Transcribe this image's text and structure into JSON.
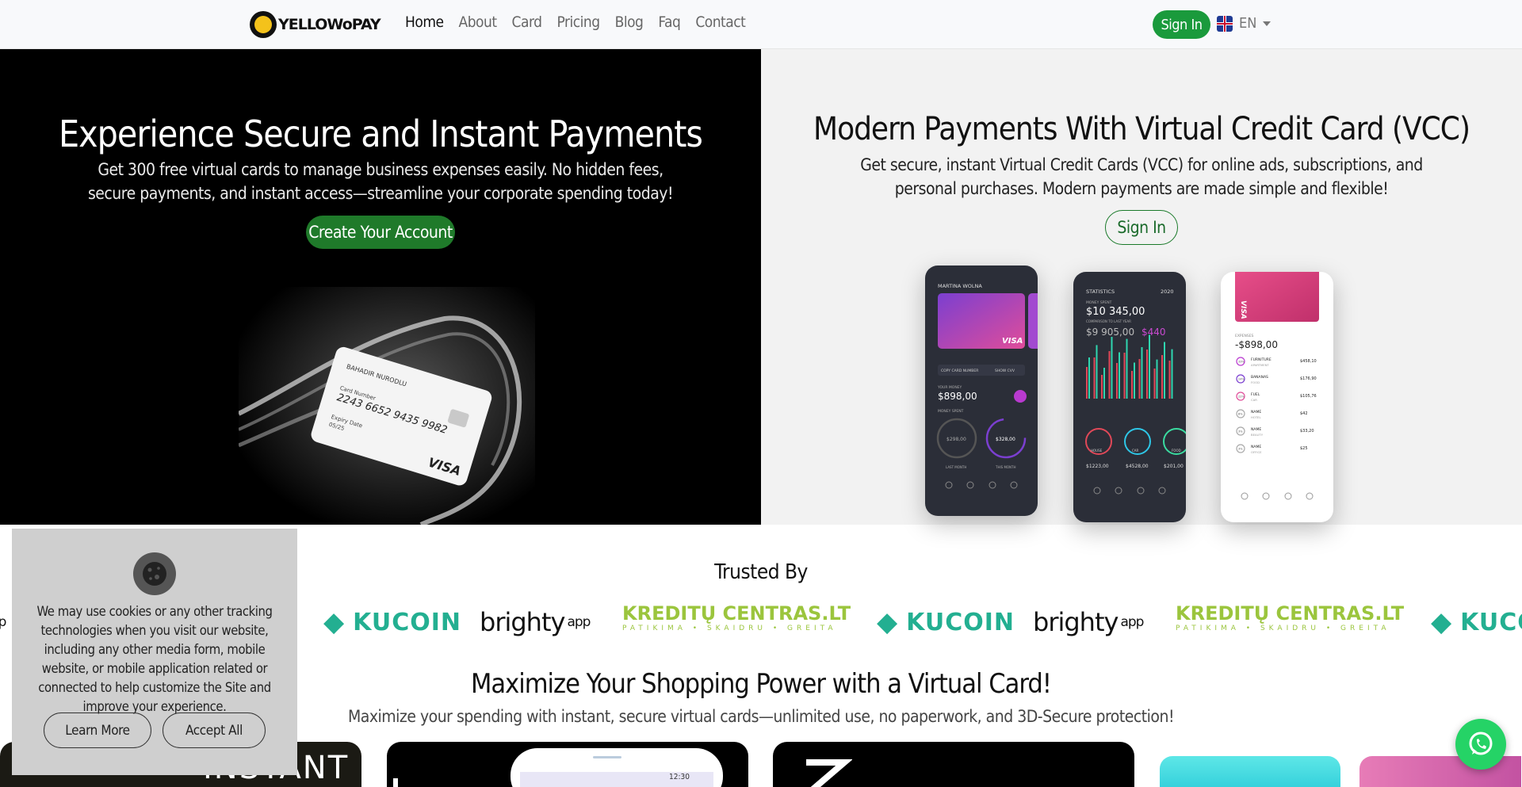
{
  "nav": {
    "logo_text": "YELLOWoPAY",
    "links": [
      "Home",
      "About",
      "Card",
      "Pricing",
      "Blog",
      "Faq",
      "Contact"
    ],
    "signin_label": "Sign In",
    "language": "EN"
  },
  "hero_left": {
    "title": "Experience Secure and Instant Payments",
    "description": "Get 300 free virtual cards to manage business expenses easily. No hidden fees, secure payments, and instant access—streamline your corporate spending today!",
    "cta_label": "Create Your Account",
    "card": {
      "holder": "BAHADIR NURODLU",
      "number_label": "Card Number",
      "number": "2243 6652 9435 9982",
      "expiry_label": "Expiry Date",
      "expiry": "05/25",
      "brand": "VISA"
    }
  },
  "hero_right": {
    "title": "Modern Payments With Virtual Credit Card (VCC)",
    "description": "Get secure, instant Virtual Credit Cards (VCC) for online ads, subscriptions, and personal purchases. Modern payments are made simple and flexible!",
    "cta_label": "Sign In",
    "phones": {
      "p1": {
        "name": "MARTINA WOLNA",
        "money_label": "YOUR MONEY",
        "money": "$898,00",
        "spent_label": "MONEY SPENT",
        "ring1": "$298,00",
        "ring2": "$328,00",
        "ring1_label": "LAST MONTH",
        "ring2_label": "THIS MONTH",
        "copy": "COPY CARD NUMBER",
        "show": "SHOW CVV"
      },
      "p2": {
        "title": "STATISTICS",
        "year": "2020",
        "spent_label": "MONEY SPENT",
        "spent": "$10 345,00",
        "compare_label": "COMPARISON TO LAST YEAR",
        "compare": "$9 905,00",
        "delta": "$440",
        "rings": [
          {
            "label": "HOUSE",
            "value": "$1223,00"
          },
          {
            "label": "CAR",
            "value": "$4528,00"
          },
          {
            "label": "FOOD",
            "value": "$201,00"
          }
        ]
      },
      "p3": {
        "expenses_label": "EXPENSES",
        "expenses": "-$898,00",
        "rows": [
          {
            "pct": "33%",
            "name": "FURNITURE",
            "sub": "APARTMENT",
            "amount": "$458,10"
          },
          {
            "pct": "24%",
            "name": "BANANAS",
            "sub": "FOOD",
            "amount": "$176,90"
          },
          {
            "pct": "22%",
            "name": "FUEL",
            "sub": "CAR",
            "amount": "$105,76"
          },
          {
            "pct": "8%",
            "name": "NAME",
            "sub": "HOTEL",
            "amount": "$42"
          },
          {
            "pct": "3%",
            "name": "NAME",
            "sub": "BEAUTY",
            "amount": "$33,20"
          },
          {
            "pct": "3%",
            "name": "NAME",
            "sub": "OFFICE",
            "amount": "$25"
          }
        ]
      }
    }
  },
  "trusted": {
    "title": "Trusted By",
    "brands": [
      {
        "type": "kucoin",
        "text": "KUCOIN"
      },
      {
        "type": "brighty",
        "text": "brighty",
        "suffix": "app"
      },
      {
        "type": "kredity",
        "text": "KREDITŲ CENTRAS.LT",
        "sub": "PATIKIMA • SKAIDRU • GREITA"
      }
    ]
  },
  "maximize": {
    "title": "Maximize Your Shopping Power with a Virtual Card!",
    "subtitle": "Maximize your spending with instant, secure virtual cards—unlimited use, no paperwork, and 3D-Secure protection!"
  },
  "tiles": {
    "t1_text": "INSTANT",
    "t2_time": "12:30"
  },
  "cookie": {
    "text": "We may use cookies or any other tracking technologies when you visit our website, including any other media form, mobile website, or mobile application related or connected to help customize the Site and improve your experience.",
    "learn_more": "Learn More",
    "accept_all": "Accept All"
  },
  "colors": {
    "primary_green": "#1a9a3c",
    "kucoin": "#23af91",
    "kredity": "#9bc53d",
    "whatsapp": "#25d366"
  }
}
